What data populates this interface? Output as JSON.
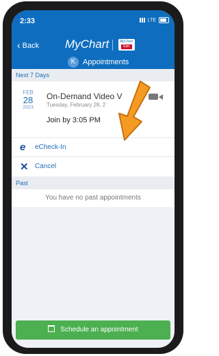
{
  "status_bar": {
    "time": "2:33",
    "network": "LTE"
  },
  "nav": {
    "back_label": "Back",
    "app_title": "MyChart",
    "epic_mini": "MyChart",
    "epic_name": "Epic"
  },
  "subheader": {
    "avatar_initial": "K",
    "title": "Appointments"
  },
  "upcoming": {
    "section_title": "Next 7 Days",
    "appointment": {
      "month": "FEB",
      "day": "28",
      "year": "2023",
      "title": "On-Demand Video V",
      "subtitle": "Tuesday, February 28, 2",
      "join_text": "Join by 3:05 PM"
    },
    "actions": [
      {
        "label": "eCheck-In",
        "icon": "echeckin-icon"
      },
      {
        "label": "Cancel",
        "icon": "close-icon"
      }
    ]
  },
  "past": {
    "section_title": "Past",
    "empty_text": "You have no past appointments"
  },
  "schedule_button": {
    "label": "Schedule an appointment",
    "icon": "calendar-icon"
  },
  "colors": {
    "brand_blue": "#0f6dbf",
    "schedule_green": "#4caf50",
    "annotation_arrow": "#f59a23"
  }
}
